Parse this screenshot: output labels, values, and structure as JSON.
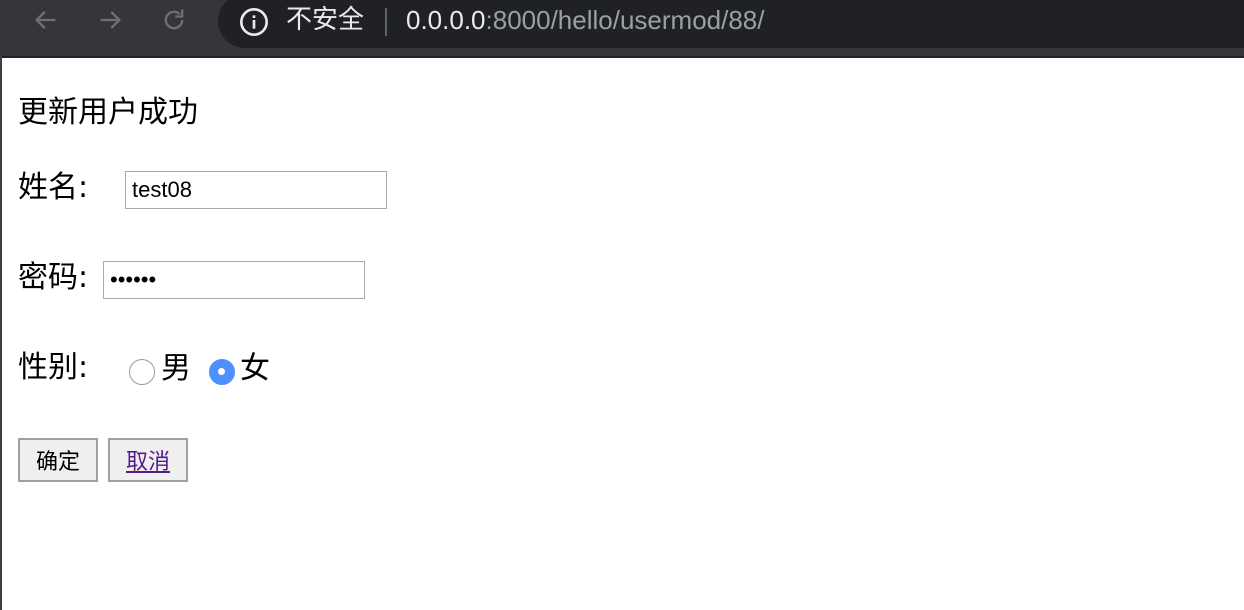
{
  "browser": {
    "security_label": "不安全",
    "url_host": "0.0.0.0",
    "url_rest": ":8000/hello/usermod/88/",
    "icons": [
      "back-arrow-icon",
      "forward-arrow-icon",
      "reload-icon",
      "info-circle-icon"
    ]
  },
  "page": {
    "heading": "更新用户成功",
    "name_label": "姓名:",
    "name_value": "test08",
    "password_label": "密码:",
    "password_value": "••••••",
    "gender_label": "性别:",
    "gender_options": [
      "男",
      "女"
    ],
    "gender_selected": "女",
    "confirm_label": "确定",
    "cancel_label": "取消"
  },
  "colors": {
    "toolbar": "#35363a",
    "omnibox": "#202124",
    "radio_checked": "#4d90fe",
    "link": "#551a8b"
  }
}
